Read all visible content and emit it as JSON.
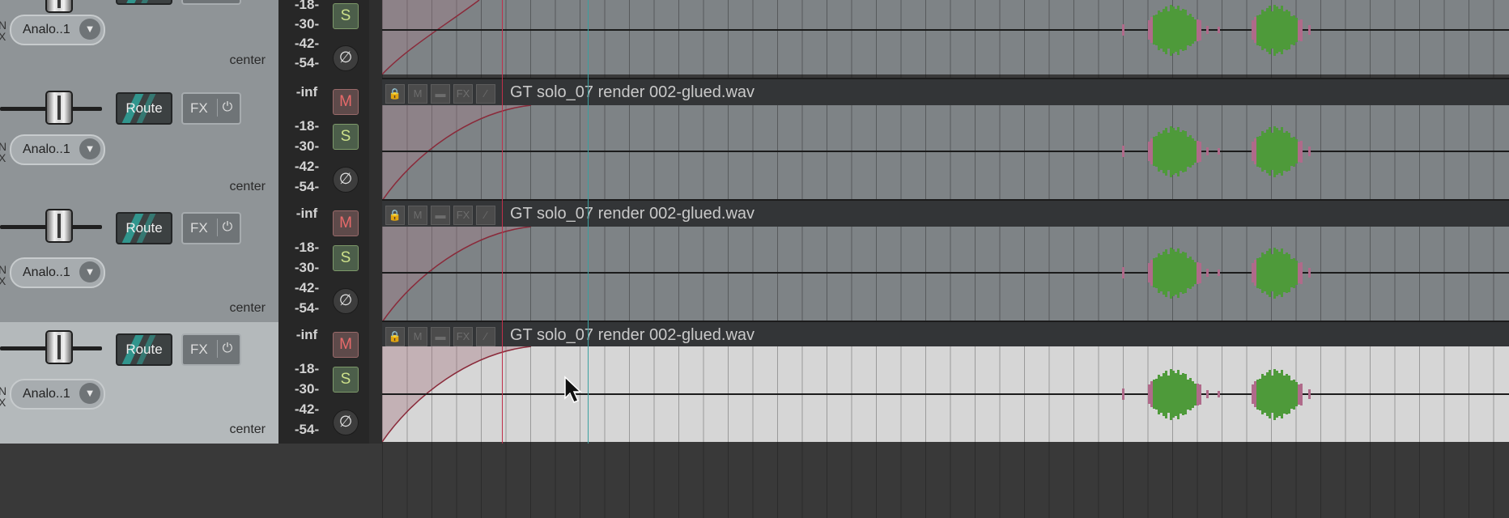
{
  "tracks": [
    {
      "id": "track-1",
      "meter": {
        "peak": "",
        "db_scale": [
          "-18-",
          "-30-",
          "-42-",
          "-54-"
        ]
      },
      "buttons": {
        "mute": "",
        "solo": "S",
        "phase": "∅"
      },
      "input_label": "Analo..1",
      "io_labels": [
        "N",
        "X"
      ],
      "pan": "center",
      "has_header": false
    },
    {
      "id": "track-2",
      "meter": {
        "peak": "-inf",
        "db_scale": [
          "-18-",
          "-30-",
          "-42-",
          "-54-"
        ]
      },
      "buttons": {
        "mute": "M",
        "solo": "S",
        "phase": "∅"
      },
      "route_label": "Route",
      "fx_label": "FX",
      "input_label": "Analo..1",
      "io_labels": [
        "N",
        "X"
      ],
      "pan": "center",
      "item_name": "GT solo_07 render 002-glued.wav"
    },
    {
      "id": "track-3",
      "meter": {
        "peak": "-inf",
        "db_scale": [
          "-18-",
          "-30-",
          "-42-",
          "-54-"
        ]
      },
      "buttons": {
        "mute": "M",
        "solo": "S",
        "phase": "∅"
      },
      "route_label": "Route",
      "fx_label": "FX",
      "input_label": "Analo..1",
      "io_labels": [
        "N",
        "X"
      ],
      "pan": "center",
      "item_name": "GT solo_07 render 002-glued.wav"
    },
    {
      "id": "track-4",
      "meter": {
        "peak": "-inf",
        "db_scale": [
          "-18-",
          "-30-",
          "-42-",
          "-54-"
        ]
      },
      "buttons": {
        "mute": "M",
        "solo": "S",
        "phase": "∅"
      },
      "route_label": "Route",
      "fx_label": "FX",
      "input_label": "Analo..1",
      "io_labels": [
        "N",
        "X"
      ],
      "pan": "center",
      "item_name": "GT solo_07 render 002-glued.wav",
      "selected": true
    }
  ],
  "item_header_icons": [
    "lock-icon",
    "mute-item-icon",
    "notes-icon",
    "fx-icon",
    "envelope-icon"
  ],
  "item_header_icon_text": {
    "m": "M",
    "fx": "FX"
  },
  "power_symbol": "⏻",
  "dropdown_arrow": "▼",
  "colors": {
    "edit_cursor": "#c0304a",
    "play_cursor": "#3aa0a0",
    "waveform": "#4e9a3a",
    "waveform_peak": "#b06a8a",
    "mute_red": "#e86a6a",
    "solo_green": "#cde08a",
    "route_teal": "#2fa59a"
  }
}
